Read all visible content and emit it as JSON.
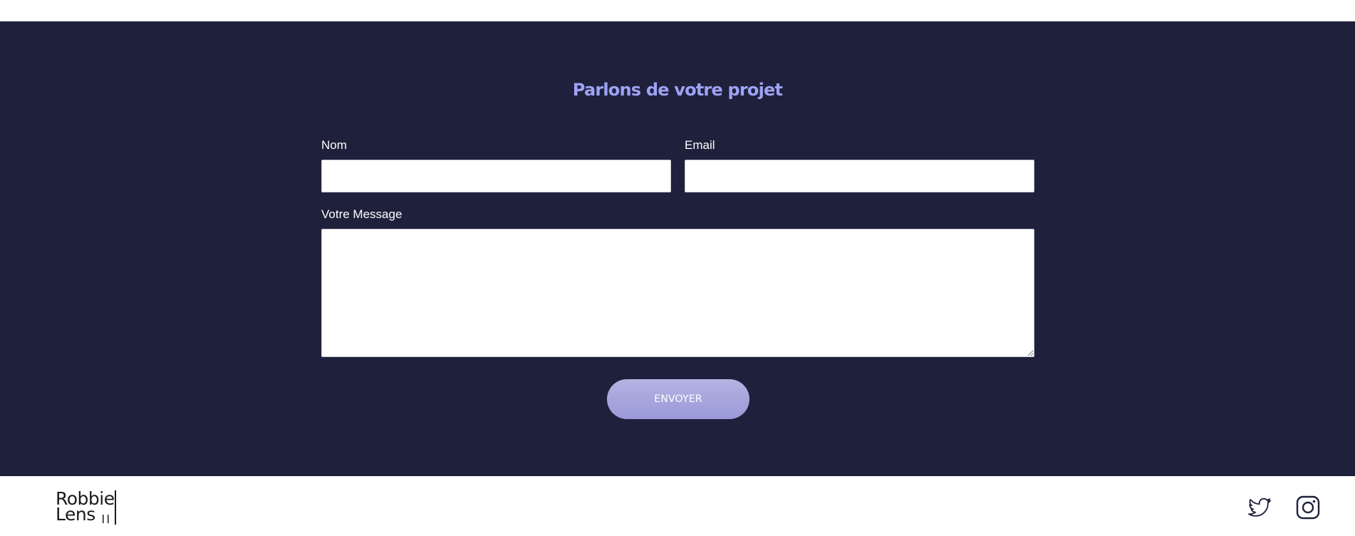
{
  "contact": {
    "title": "Parlons de votre projet",
    "name_label": "Nom",
    "name_value": "",
    "email_label": "Email",
    "email_value": "",
    "message_label": "Votre Message",
    "message_value": "",
    "submit_label": "ENVOYER"
  },
  "footer": {
    "logo_line1": "Robbie",
    "logo_line2": "Lens",
    "social_icons": [
      "twitter-icon",
      "instagram-icon"
    ]
  },
  "colors": {
    "section_background": "#1f203b",
    "title_accent": "#9ea3f5",
    "button_gradient_top": "#b3b3e3",
    "button_gradient_bottom": "#9a99d8"
  }
}
